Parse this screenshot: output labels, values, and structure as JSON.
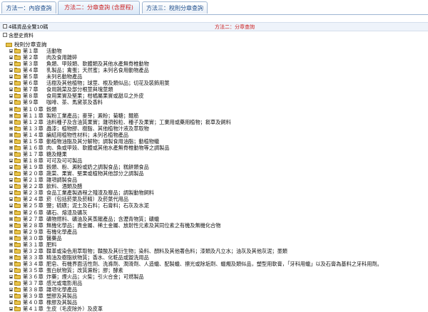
{
  "tabs": [
    {
      "label": "方法一：內容查詢",
      "active": false
    },
    {
      "label": "方法二：分章查詢 (含歷程)",
      "active": true
    },
    {
      "label": "方法三：稅則分章查詢",
      "active": false
    }
  ],
  "options": {
    "note": "4碼貨品全覽10碼",
    "method_label": "方法二：分章查詢",
    "include_all": "含歷史資料"
  },
  "tree": {
    "root_label": "稅則分章查詢",
    "chapters": [
      {
        "no": "第１章",
        "title": "活動物"
      },
      {
        "no": "第２章",
        "title": "肉及食用雜碎"
      },
      {
        "no": "第３章",
        "title": "魚類、甲殼類、軟體類及其他水產無脊椎動物"
      },
      {
        "no": "第４章",
        "title": "乳製品；禽蛋；天然蜜；未列名食用動物產品"
      },
      {
        "no": "第５章",
        "title": "未列名動物產品"
      },
      {
        "no": "第６章",
        "title": "活樹及其他植物；球莖、根及類似品；切花及裝飾用葉"
      },
      {
        "no": "第７章",
        "title": "食用蔬菜及部分根莖與塊莖類"
      },
      {
        "no": "第８章",
        "title": "食用果實及堅果；柑橘屬果實或甜瓜之外皮"
      },
      {
        "no": "第９章",
        "title": "咖啡、茶、馬黛茶及香料"
      },
      {
        "no": "第１０章",
        "title": "穀類"
      },
      {
        "no": "第１１章",
        "title": "製粉工業產品；麥芽；澱粉；菊糖；麵筋"
      },
      {
        "no": "第１２章",
        "title": "油料種子及含油質果實；雜項穀粒、種子及果實；工業用或藥用植物；芻草及飼料"
      },
      {
        "no": "第１３章",
        "title": "蟲漆；植物膠、樹脂、其他植物汁液及萃取物"
      },
      {
        "no": "第１４章",
        "title": "編結用植物性材料；未列名植物產品"
      },
      {
        "no": "第１５章",
        "title": "動植物油脂及其分解物；調製食用油脂；動植物蠟"
      },
      {
        "no": "第１６章",
        "title": "肉、魚或甲殼、軟體或其他水產無脊椎動物等之調製品"
      },
      {
        "no": "第１７章",
        "title": "糖及糖果"
      },
      {
        "no": "第１８章",
        "title": "可可及可可製品"
      },
      {
        "no": "第１９章",
        "title": "穀類、粉、澱粉或奶之調製食品；糕餅類食品"
      },
      {
        "no": "第２０章",
        "title": "蔬菜、果實、堅果或植物其他部分之調製品"
      },
      {
        "no": "第２１章",
        "title": "雜項調製食品"
      },
      {
        "no": "第２２章",
        "title": "飲料、酒類及醋"
      },
      {
        "no": "第２３章",
        "title": "食品工業產製過程之殘渣及廢品；調製動物飼料"
      },
      {
        "no": "第２４章",
        "title": "菸（包括菸葉及菸精）及菸葉代用品"
      },
      {
        "no": "第２５章",
        "title": "鹽；硫磺；泥土及石料；石膏料；石灰及水泥"
      },
      {
        "no": "第２６章",
        "title": "礦石、熔渣及礦灰"
      },
      {
        "no": "第２７章",
        "title": "礦物燃料、礦油及其蒸餾產品；含瀝青物質；礦蠟"
      },
      {
        "no": "第２８章",
        "title": "無機化學品；貴金屬、稀土金屬、放射性元素及其同位素之有機及無機化合物"
      },
      {
        "no": "第２９章",
        "title": "有機化學產品"
      },
      {
        "no": "第３０章",
        "title": "醫藥品"
      },
      {
        "no": "第３１章",
        "title": "肥料"
      },
      {
        "no": "第３２章",
        "title": "鞣革或染色用萃取物；鞣酸及其衍生物；染料、顏料及其他著色料；漆類及凡立水；油灰及其他灰泥；墨類"
      },
      {
        "no": "第３３章",
        "title": "精油及樹脂狀物質；香水、化粧品或盥洗用品"
      },
      {
        "no": "第３４章",
        "title": "肥皂、有機界面活性劑、洗滌劑、潤滑劑、人造蠟、配製蠟、擦光或除垢劑、蠟燭及類似品，塑型用軟膏，「牙科用蠟」以及石膏為基料之牙科用劑。"
      },
      {
        "no": "第３５章",
        "title": "蛋白狀物質；改質澱粉；膠；酵素"
      },
      {
        "no": "第３６章",
        "title": "炸藥；煙火品；火柴；引火合金；可燃製品"
      },
      {
        "no": "第３７章",
        "title": "感光或電影用品"
      },
      {
        "no": "第３８章",
        "title": "雜項化學產品"
      },
      {
        "no": "第３９章",
        "title": "塑膠及其製品"
      },
      {
        "no": "第４０章",
        "title": "橡膠及其製品"
      },
      {
        "no": "第４１章",
        "title": "生皮（毛皮除外）及皮革"
      }
    ]
  }
}
